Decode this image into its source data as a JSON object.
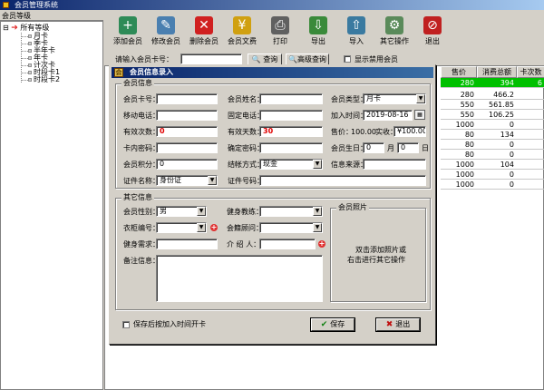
{
  "app": {
    "title": "会员管理系统"
  },
  "tree": {
    "header": "会员等级",
    "root": "所有等级",
    "items": [
      "月卡",
      "季卡",
      "半年卡",
      "年卡",
      "计次卡",
      "时段卡1",
      "时段卡2"
    ]
  },
  "toolbar": {
    "buttons": [
      {
        "label": "添加会员",
        "icon": "add-member-icon",
        "glyph": "+",
        "color": "#2e8b57"
      },
      {
        "label": "修改会员",
        "icon": "edit-member-icon",
        "glyph": "✎",
        "color": "#4a7fb0"
      },
      {
        "label": "删除会员",
        "icon": "delete-member-icon",
        "glyph": "✕",
        "color": "#d02020"
      },
      {
        "label": "会员文费",
        "icon": "coins-icon",
        "glyph": "¥",
        "color": "#d0a010"
      },
      {
        "label": "打印",
        "icon": "printer-icon",
        "glyph": "⎙",
        "color": "#606060"
      },
      {
        "label": "导出",
        "icon": "export-icon",
        "glyph": "⇩",
        "color": "#3a8a3a"
      },
      {
        "label": "导入",
        "icon": "import-icon",
        "glyph": "⇧",
        "color": "#3a7aa0"
      },
      {
        "label": "其它操作",
        "icon": "other-ops-icon",
        "glyph": "⚙",
        "color": "#5a8a5a"
      },
      {
        "label": "退出",
        "icon": "exit-icon",
        "glyph": "⊘",
        "color": "#c02020"
      }
    ]
  },
  "search": {
    "label": "请输入会员卡号：",
    "value": "",
    "query_button": "查询",
    "advanced_button": "高级查询",
    "disabled_members_label": "显示禁用会员"
  },
  "grid": {
    "columns": [
      "售价",
      "消费总额",
      "卡次数"
    ],
    "rows": [
      [
        "",
        "",
        ""
      ],
      [
        "280",
        "466.2",
        ""
      ],
      [
        "550",
        "561.85",
        ""
      ],
      [
        "550",
        "106.25",
        ""
      ],
      [
        "1000",
        "0",
        ""
      ],
      [
        "80",
        "134",
        ""
      ],
      [
        "80",
        "0",
        ""
      ],
      [
        "80",
        "0",
        ""
      ],
      [
        "1000",
        "104",
        ""
      ],
      [
        "1000",
        "0",
        ""
      ],
      [
        "1000",
        "0",
        ""
      ]
    ],
    "highlight_row": [
      "280",
      "394",
      "6"
    ],
    "highlight_color": "#00c000"
  },
  "dialog": {
    "title": "会员信息录入",
    "basic_group": "会员信息",
    "card_no_label": "会员卡号：",
    "card_no": "",
    "name_label": "会员姓名：",
    "name": "",
    "type_label": "会员类型：",
    "type": "月卡",
    "mobile_label": "移动电话：",
    "mobile": "",
    "phone_label": "固定电话：",
    "phone": "",
    "join_label": "加入时间：",
    "join_date": "2019-08-16",
    "valid_count_label": "有效次数：",
    "valid_count": "0",
    "valid_days_label": "有效天数：",
    "valid_days": "30",
    "price_label": "售价：",
    "price": "100.00",
    "paid_label": "实收：",
    "paid": "¥100.00",
    "card_pwd_label": "卡内密码：",
    "card_pwd": "",
    "confirm_pwd_label": "确定密码：",
    "confirm_pwd": "",
    "birthday_label": "会员生日：",
    "birth_month": "0",
    "month_unit": "月",
    "birth_day": "0",
    "day_unit": "日",
    "points_label": "会员积分：",
    "points": "0",
    "pay_label": "结帐方式：",
    "pay": "现金",
    "source_label": "信息来源：",
    "source": "",
    "id_type_label": "证件名称：",
    "id_type": "身份证",
    "id_no_label": "证件号码：",
    "id_no": "",
    "other_group": "其它信息",
    "gender_label": "会员性别：",
    "gender": "男",
    "coach_label": "健身教练：",
    "coach": "",
    "locker_label": "衣柜编号：",
    "locker": "",
    "advisor_label": "会籍顾问：",
    "advisor": "",
    "needs_label": "健身需求：",
    "needs": "",
    "referrer_label": "介 绍 人：",
    "referrer": "",
    "notes_label": "备注信息：",
    "notes": "",
    "photo_group": "会员照片",
    "photo_hint_1": "双击添加照片或",
    "photo_hint_2": "右击进行其它操作",
    "save_open_label": "保存后按加入时间开卡",
    "save_button": "保存",
    "exit_button": "退出"
  }
}
